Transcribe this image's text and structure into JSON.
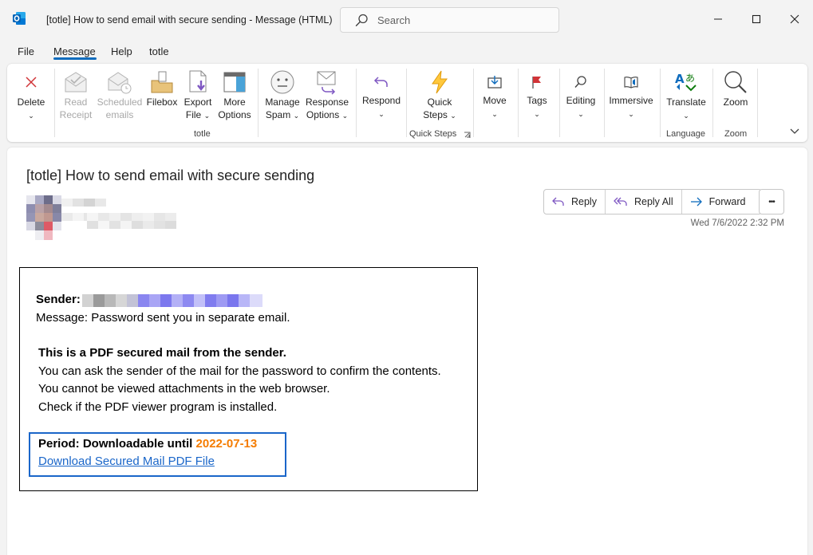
{
  "window": {
    "title": "[totle] How to send email with secure sending  -  Message (HTML)",
    "search_placeholder": "Search"
  },
  "menu": [
    "File",
    "Message",
    "Help",
    "totle"
  ],
  "ribbon": {
    "delete": "Delete",
    "read_receipt": [
      "Read",
      "Receipt"
    ],
    "scheduled_emails": [
      "Scheduled",
      "emails"
    ],
    "filebox": "Filebox",
    "export_file": [
      "Export",
      "File"
    ],
    "more_options": [
      "More",
      "Options"
    ],
    "manage_spam": [
      "Manage",
      "Spam"
    ],
    "response_options": [
      "Response",
      "Options"
    ],
    "group_totle": "totle",
    "respond": "Respond",
    "quick_steps": [
      "Quick",
      "Steps"
    ],
    "group_quick_steps": "Quick Steps",
    "move": "Move",
    "tags": "Tags",
    "editing": "Editing",
    "immersive": "Immersive",
    "translate": "Translate",
    "group_language": "Language",
    "zoom": "Zoom",
    "group_zoom": "Zoom",
    "chevron": "⌄"
  },
  "message": {
    "subject": "[totle] How to send email with secure sending",
    "reply": "Reply",
    "reply_all": "Reply All",
    "forward": "Forward",
    "more": "•••",
    "date": "Wed 7/6/2022 2:32 PM"
  },
  "body": {
    "sender_label": "Sender:",
    "message_line": "Message: Password sent you in separate email.",
    "heading": "This is a PDF secured mail from the sender.",
    "line1": "You can ask the sender of the mail for the password to confirm the contents.",
    "line2": "You cannot be viewed attachments in the web browser.",
    "line3": "Check if the PDF viewer program is installed.",
    "period_label": "Period: Downloadable until ",
    "period_date": "2022-07-13",
    "download_link": "Download Secured Mail PDF File"
  },
  "colors": {
    "accent": "#0f6cbd",
    "link": "#1a66c9",
    "date_highlight": "#f57c00"
  }
}
